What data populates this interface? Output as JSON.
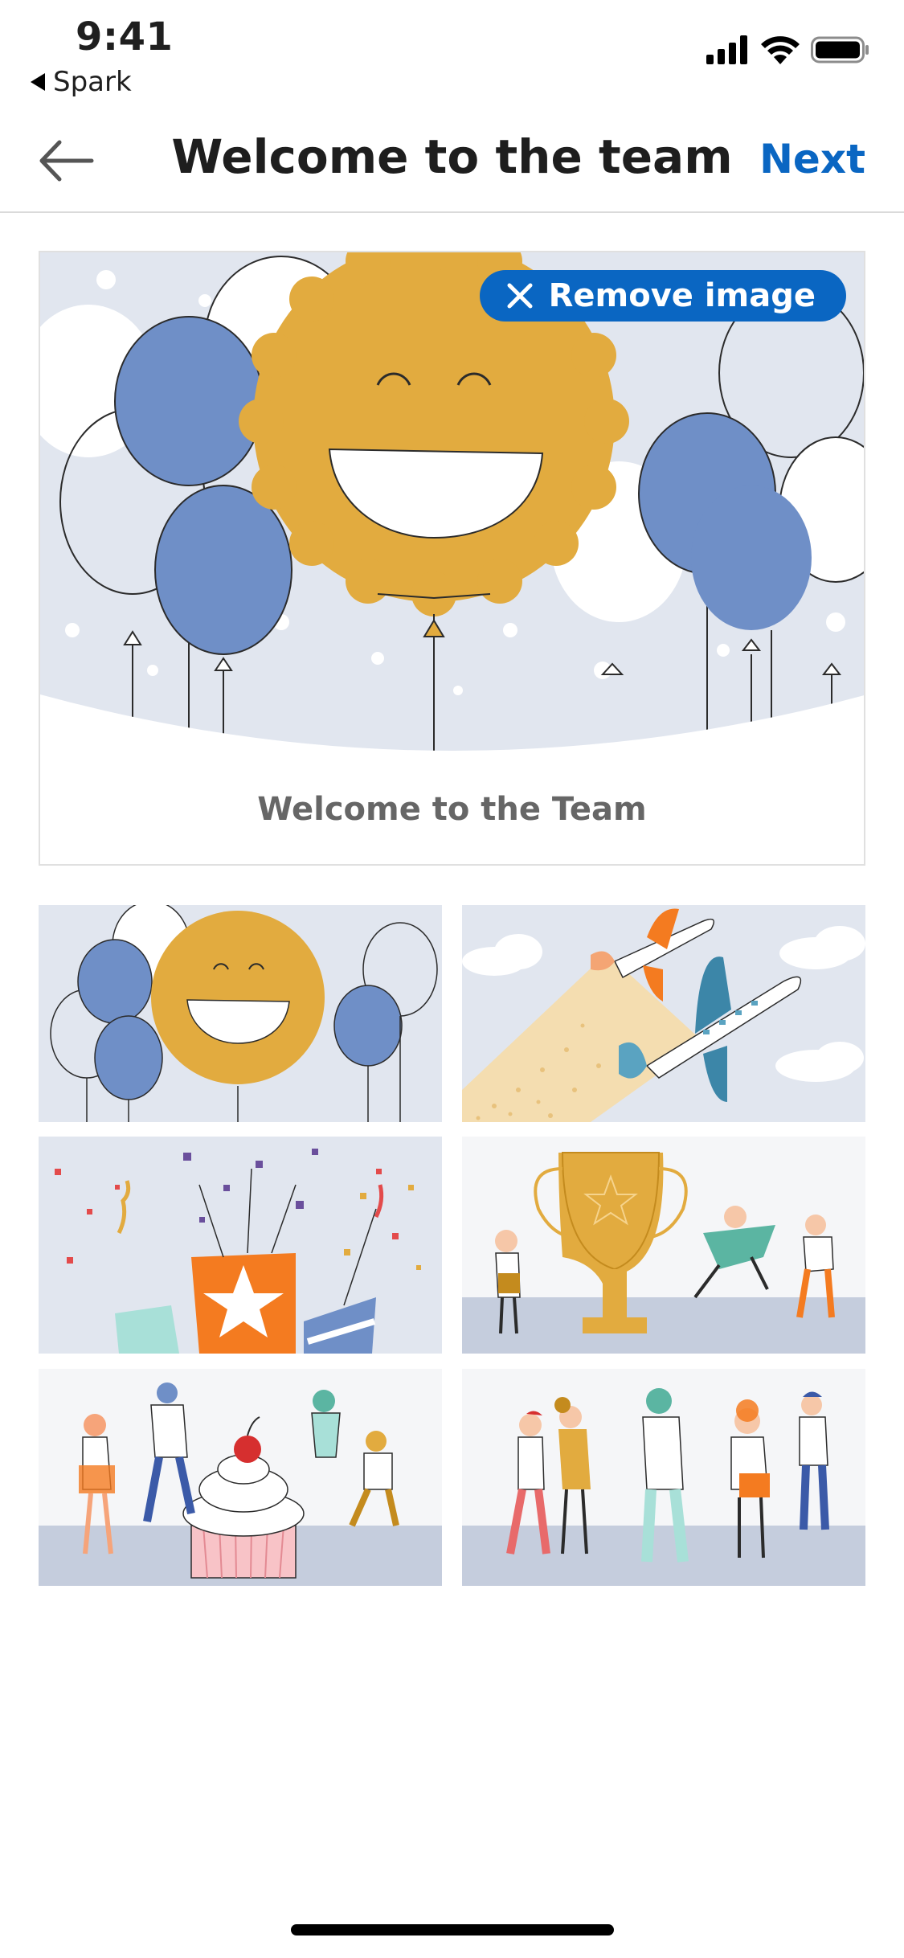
{
  "status_bar": {
    "time": "9:41",
    "back_app": "Spark",
    "icons": [
      "signal-icon",
      "wifi-icon",
      "battery-icon"
    ]
  },
  "nav": {
    "back_icon": "back-arrow-icon",
    "title": "Welcome to the team",
    "next_label": "Next"
  },
  "preview": {
    "remove_label": "Remove image",
    "remove_icon": "close-icon",
    "caption": "Welcome to the Team"
  },
  "thumbnails": [
    {
      "name": "balloons-smiley",
      "selected": true
    },
    {
      "name": "airplanes",
      "selected": false
    },
    {
      "name": "confetti-party-poppers",
      "selected": false
    },
    {
      "name": "trophy-celebration",
      "selected": false
    },
    {
      "name": "cupcake-celebration",
      "selected": false
    },
    {
      "name": "team-greeting",
      "selected": false
    }
  ],
  "colors": {
    "accent": "#0a66c2",
    "balloon_blue": "#6f8fc7",
    "smiley_gold": "#e2ab3f",
    "background_gray": "#e1e6ef",
    "orange": "#f47b20"
  }
}
